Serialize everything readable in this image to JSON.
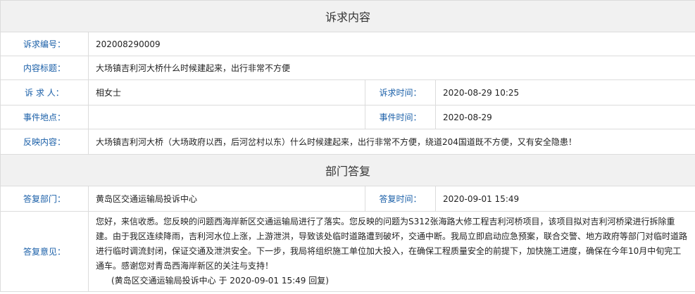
{
  "complaint": {
    "title": "诉求内容",
    "rows": {
      "number": {
        "label": "诉求编号：",
        "value": "202008290009"
      },
      "subject": {
        "label": "内容标题：",
        "value": "大场镇吉利河大桥什么时候建起来，出行非常不方便"
      },
      "person": {
        "label": "诉 求 人：",
        "value": "相女士",
        "time_label": "诉求时间：",
        "time_value": "2020-08-29 10:25"
      },
      "location": {
        "label": "事件地点：",
        "value": "",
        "time_label": "事件时间：",
        "time_value": "2020-08-29"
      },
      "content": {
        "label": "反映内容：",
        "value": "大场镇吉利河大桥（大场政府以西，后河岔村以东）什么时候建起来，出行非常不方便，绕道204国道既不方便，又有安全隐患！"
      }
    }
  },
  "reply": {
    "title": "部门答复",
    "dept_label": "答复部门：",
    "dept_value": "黄岛区交通运输局投诉中心",
    "time_label": "答复时间：",
    "time_value": "2020-09-01 15:49",
    "opinion_label": "答复意见：",
    "opinion_text": "您好，来信收悉。您反映的问题西海岸新区交通运输局进行了落实。您反映的问题为S312张海路大修工程吉利河桥项目，该项目拟对吉利河桥梁进行拆除重建。由于我区连续降雨，吉利河水位上涨，上游泄洪，导致该处临时道路遭到破坏，交通中断。我局立即启动应急预案，联合交警、地方政府等部门对临时道路进行临时调流封闭，保证交通及泄洪安全。下一步，我局将组织施工单位加大投入，在确保工程质量安全的前提下，加快施工进度，确保在今年10月中旬完工通车。感谢您对青岛西海岸新区的关注与支持！",
    "opinion_sign": "(黄岛区交通运输局投诉中心 于 2020-09-01 15:49 回复)"
  }
}
